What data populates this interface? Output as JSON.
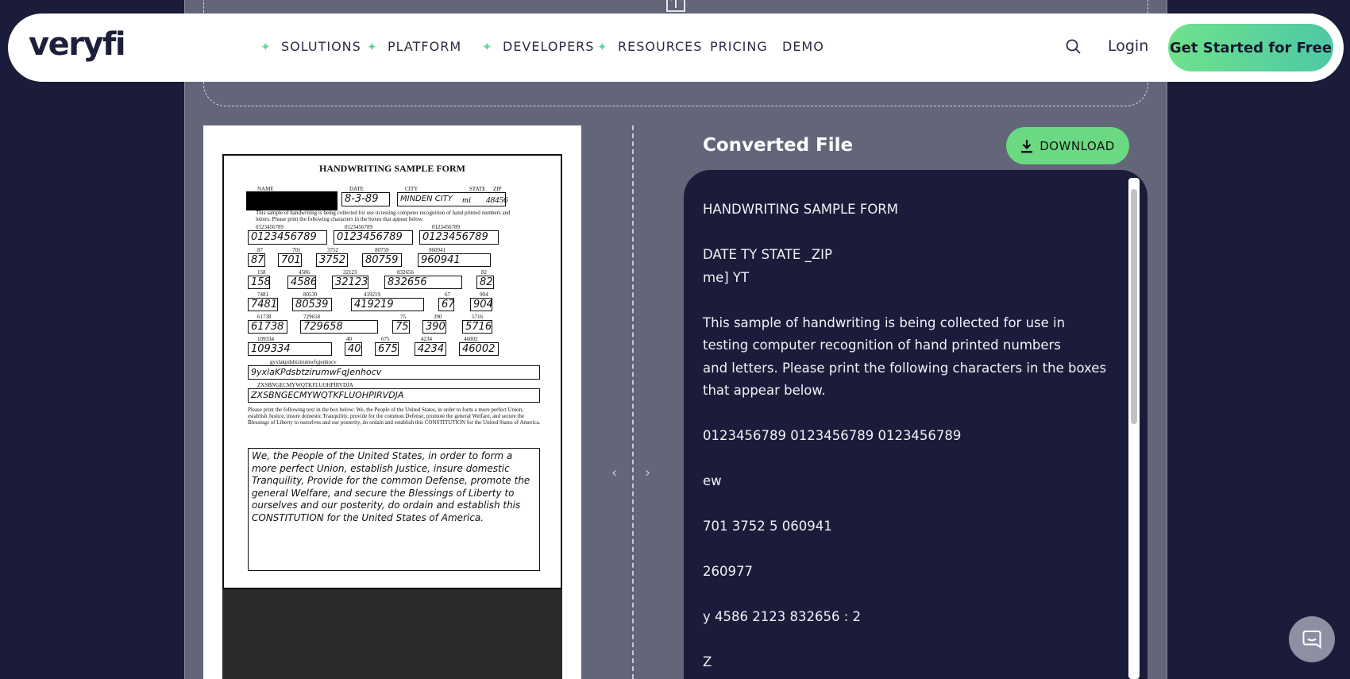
{
  "navbar": {
    "logo": "veryfi",
    "items": [
      "SOLUTIONS",
      "PLATFORM",
      "DEVELOPERS",
      "RESOURCES",
      "PRICING",
      "DEMO"
    ],
    "login": "Login",
    "cta": "Get Started for Free"
  },
  "preview": {
    "title": "HANDWRITING SAMPLE FORM",
    "labels": {
      "name": "NAME",
      "date": "DATE",
      "city": "CITY",
      "state": "STATE",
      "zip": "ZIP"
    },
    "date_value": "8-3-89",
    "city_value": "MINDEN CITY",
    "state_value": "mi",
    "zip_value": "48456",
    "intro": "This sample of handwriting is being collected for use in testing computer recognition of hand printed numbers and letters. Please print the following characters in the boxes that appear below.",
    "digits_label": "0123456789",
    "row1": [
      "0123456789",
      "0123456789",
      "0123456789"
    ],
    "row2_labels": [
      "87",
      "701",
      "3752",
      "80759",
      "960941"
    ],
    "row2": [
      "87",
      "701",
      "3752",
      "80759",
      "960941"
    ],
    "row3_labels": [
      "158",
      "4586",
      "32123",
      "832656",
      "82"
    ],
    "row3": [
      "158",
      "4586",
      "32123",
      "832656",
      "82"
    ],
    "row4_labels": [
      "7481",
      "80539",
      "419219",
      "67",
      "904"
    ],
    "row4": [
      "7481",
      "80539",
      "419219",
      "67",
      "904"
    ],
    "row5_labels": [
      "61738",
      "729658",
      "75",
      "390",
      "5716"
    ],
    "row5": [
      "61738",
      "729658",
      "75",
      "390",
      "5716"
    ],
    "row6_labels": [
      "109334",
      "40",
      "675",
      "4234",
      "46002"
    ],
    "row6": [
      "109334",
      "40",
      "675",
      "4234",
      "46002"
    ],
    "lower_label": "gyxlakpdsbtzirumwfqjenhocv",
    "lower_value": "9yxlaKPdsbtzirumwFqJenhocv",
    "upper_label": "ZXSBNGECMYWQTKFLUOHPIRVDJA",
    "upper_value": "ZXSBNGECMYWQTKFLUOHPIRVDJA",
    "instructions": "Please print the following text in the box below: We, the People of the United States, in order to form a more perfect Union, establish Justice, insure domestic Tranquility, provide for the common Defense, promote the general Welfare, and secure the Blessings of Liberty to ourselves and our posterity, do ordain and establish this CONSTITUTION for the United States of America.",
    "handwritten": "We, the People of the United States, in order to form a more perfect Union, establish Justice, insure domestic Tranquility, Provide for the common Defense, promote the general Welfare, and secure the Blessings of Liberty to ourselves and our posterity, do ordain and establish this CONSTITUTION for the United States of America."
  },
  "converted": {
    "title": "Converted File",
    "download": "DOWNLOAD",
    "lines": [
      "HANDWRITING SAMPLE FORM",
      "",
      "DATE TY STATE _ZIP",
      "me] YT",
      "",
      "This sample of handwriting is being collected for use in",
      "testing computer recognition of hand printed numbers",
      "and letters. Please print the following characters in the boxes",
      "that appear below.",
      "",
      "0123456789 0123456789 0123456789",
      "",
      "ew",
      "",
      "701 3752 5 060941",
      "",
      "260977",
      "",
      "y 4586 2123 832656 : 2",
      "",
      "Z"
    ]
  },
  "colors": {
    "background": "#1b1c3a",
    "panel": "#636579",
    "accent_green": "#6bd982",
    "cta_gradient_end": "#4dc8a5"
  },
  "icons": [
    "upload-icon",
    "spark-icon",
    "search-icon",
    "download-icon",
    "chevron-left-icon",
    "chevron-right-icon",
    "chat-icon"
  ]
}
